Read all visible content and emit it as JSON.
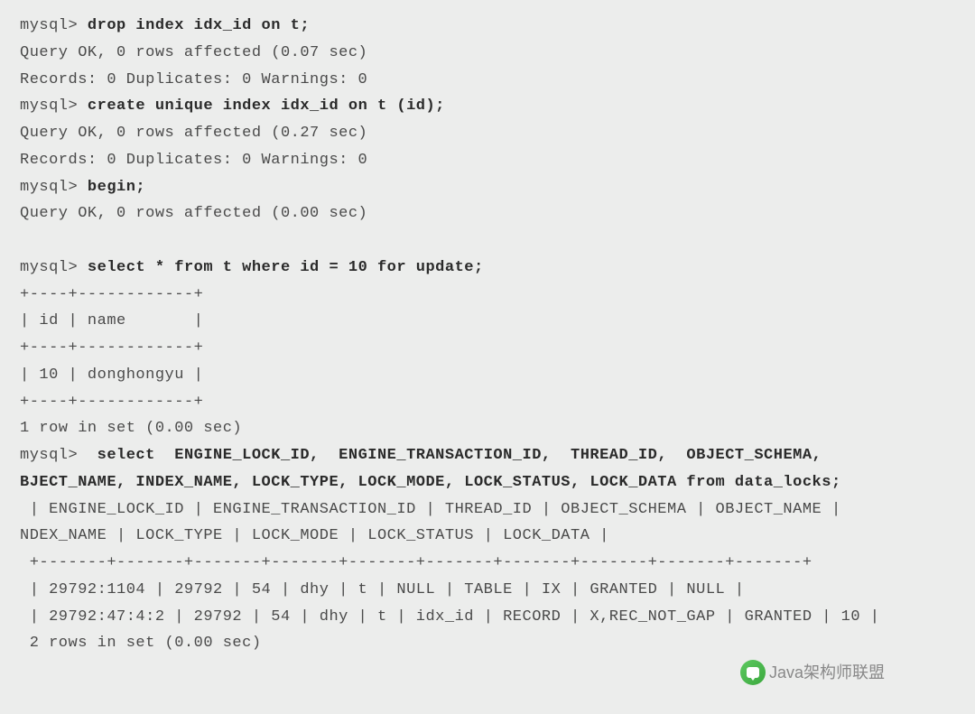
{
  "terminal": {
    "lines": [
      {
        "type": "cmd",
        "prompt": "mysql> ",
        "command": "drop index idx_id on t;"
      },
      {
        "type": "out",
        "text": "Query OK, 0 rows affected (0.07 sec)"
      },
      {
        "type": "out",
        "text": "Records: 0 Duplicates: 0 Warnings: 0"
      },
      {
        "type": "cmd",
        "prompt": "mysql> ",
        "command": "create unique index idx_id on t (id);"
      },
      {
        "type": "out",
        "text": "Query OK, 0 rows affected (0.27 sec)"
      },
      {
        "type": "out",
        "text": "Records: 0 Duplicates: 0 Warnings: 0"
      },
      {
        "type": "cmd",
        "prompt": "mysql> ",
        "command": "begin;"
      },
      {
        "type": "out",
        "text": "Query OK, 0 rows affected (0.00 sec)"
      },
      {
        "type": "blank"
      },
      {
        "type": "cmd",
        "prompt": "mysql> ",
        "command": "select * from t where id = 10 for update;"
      },
      {
        "type": "out",
        "text": "+----+------------+"
      },
      {
        "type": "out",
        "text": "| id | name       |"
      },
      {
        "type": "out",
        "text": "+----+------------+"
      },
      {
        "type": "out",
        "text": "| 10 | donghongyu |"
      },
      {
        "type": "out",
        "text": "+----+------------+"
      },
      {
        "type": "out",
        "text": "1 row in set (0.00 sec)"
      },
      {
        "type": "cmd",
        "prompt": "mysql> ",
        "command": " select  ENGINE_LOCK_ID,  ENGINE_TRANSACTION_ID,  THREAD_ID,  OBJECT_SCHEMA, "
      },
      {
        "type": "cmdcont",
        "command": "BJECT_NAME, INDEX_NAME, LOCK_TYPE, LOCK_MODE, LOCK_STATUS, LOCK_DATA from data_locks;"
      },
      {
        "type": "out",
        "text": " | ENGINE_LOCK_ID | ENGINE_TRANSACTION_ID | THREAD_ID | OBJECT_SCHEMA | OBJECT_NAME | "
      },
      {
        "type": "out",
        "text": "NDEX_NAME | LOCK_TYPE | LOCK_MODE | LOCK_STATUS | LOCK_DATA |"
      },
      {
        "type": "out",
        "text": " +-------+-------+-------+-------+-------+-------+-------+-------+-------+-------+"
      },
      {
        "type": "out",
        "text": " | 29792:1104 | 29792 | 54 | dhy | t | NULL | TABLE | IX | GRANTED | NULL |"
      },
      {
        "type": "out",
        "text": " | 29792:47:4:2 | 29792 | 54 | dhy | t | idx_id | RECORD | X,REC_NOT_GAP | GRANTED | 10 |"
      },
      {
        "type": "out",
        "text": " 2 rows in set (0.00 sec)"
      }
    ]
  },
  "watermark": {
    "text": "Java架构师联盟"
  },
  "chart_data": {
    "type": "table",
    "title": "data_locks query result",
    "columns": [
      "ENGINE_LOCK_ID",
      "ENGINE_TRANSACTION_ID",
      "THREAD_ID",
      "OBJECT_SCHEMA",
      "OBJECT_NAME",
      "INDEX_NAME",
      "LOCK_TYPE",
      "LOCK_MODE",
      "LOCK_STATUS",
      "LOCK_DATA"
    ],
    "rows": [
      [
        "29792:1104",
        "29792",
        "54",
        "dhy",
        "t",
        "NULL",
        "TABLE",
        "IX",
        "GRANTED",
        "NULL"
      ],
      [
        "29792:47:4:2",
        "29792",
        "54",
        "dhy",
        "t",
        "idx_id",
        "RECORD",
        "X,REC_NOT_GAP",
        "GRANTED",
        "10"
      ]
    ]
  }
}
